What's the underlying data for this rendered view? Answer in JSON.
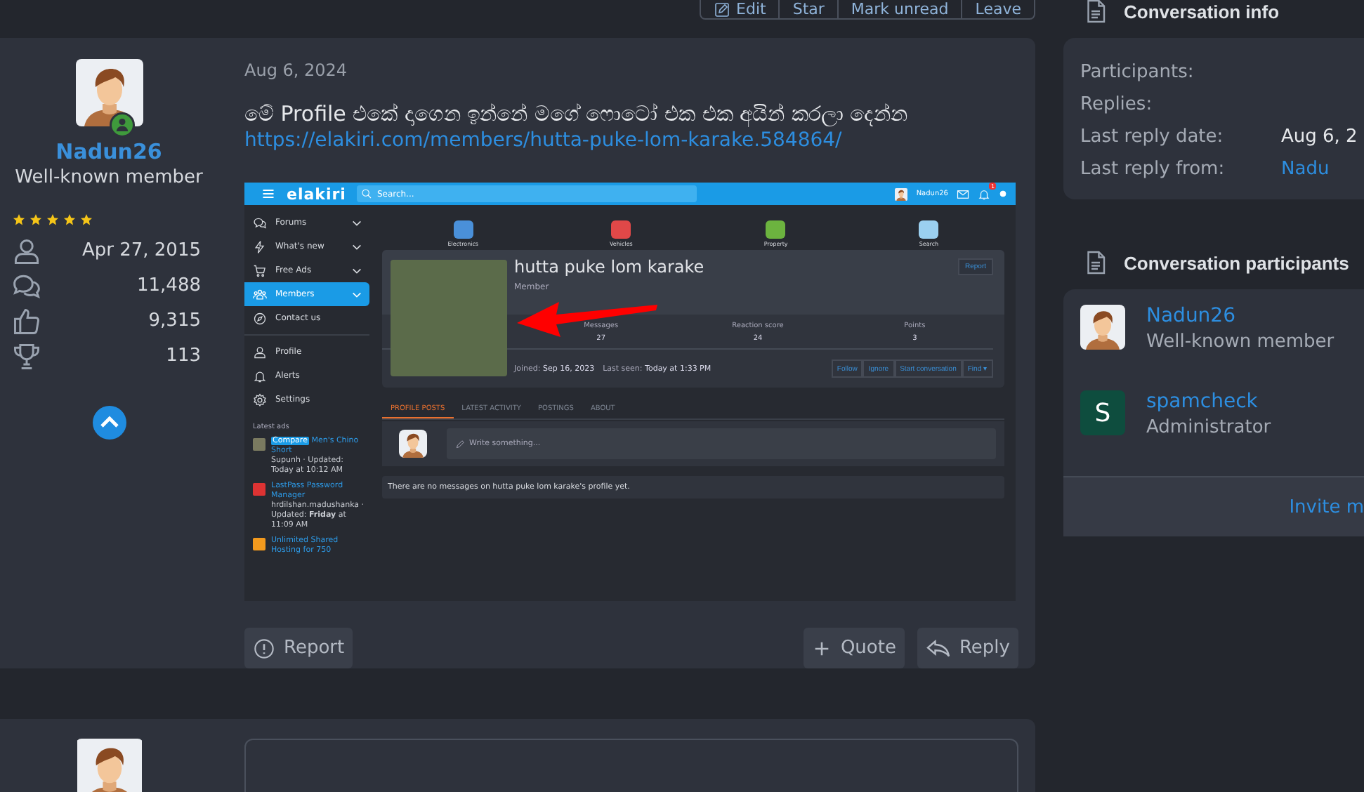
{
  "toolbar": {
    "buttons": [
      {
        "label": "Edit",
        "kind": "edit"
      },
      {
        "label": "Star",
        "kind": "plain"
      },
      {
        "label": "Mark unread",
        "kind": "plain"
      },
      {
        "label": "Leave",
        "kind": "plain"
      }
    ]
  },
  "post": {
    "author": {
      "name": "Nadun26",
      "title": "Well-known member",
      "online": true,
      "stars": 5,
      "stats": [
        {
          "kind": "joined",
          "value": "Apr 27, 2015"
        },
        {
          "kind": "messages",
          "value": "11,488"
        },
        {
          "kind": "reactions",
          "value": "9,315"
        },
        {
          "kind": "trophies",
          "value": "113"
        }
      ]
    },
    "date": "Aug 6, 2024",
    "message": "මේ Profile එකේ දාගෙන ඉන්නේ මගේ ෆොටෝ එක එක අයින් කරලා දෙන්න",
    "link": "https://elakiri.com/members/hutta-puke-lom-karake.584864/",
    "attachment": {
      "logo": "elakiri",
      "search_placeholder": "Search...",
      "user": "Nadun26",
      "alert_count": "1",
      "categories": [
        {
          "label": "Electronics",
          "kind": "electronics"
        },
        {
          "label": "Vehicles",
          "kind": "vehicles"
        },
        {
          "label": "Property",
          "kind": "property"
        },
        {
          "label": "Search",
          "kind": "search"
        }
      ],
      "nav": [
        {
          "label": "Forums",
          "kind": "forums",
          "selected": false,
          "dropdown": true
        },
        {
          "label": "What's new",
          "kind": "new",
          "selected": false,
          "dropdown": true
        },
        {
          "label": "Free Ads",
          "kind": "cart",
          "selected": false,
          "dropdown": true
        },
        {
          "label": "Members",
          "kind": "members",
          "selected": true,
          "dropdown": true
        },
        {
          "label": "Contact us",
          "kind": "contact",
          "selected": false,
          "dropdown": false
        }
      ],
      "account_nav": [
        {
          "label": "Profile",
          "kind": "profile"
        },
        {
          "label": "Alerts",
          "kind": "alerts"
        },
        {
          "label": "Settings",
          "kind": "settings"
        }
      ],
      "latest_ads_title": "Latest ads",
      "ads": [
        {
          "tag": "Compare",
          "title": "Men's Chino Short",
          "meta": "Supunh · Updated: Today at 10:12 AM",
          "kind": "clothes"
        },
        {
          "title": "LastPass Password Manager",
          "meta": "hrdilshan.madushanka · Updated: **Friday** at 11:09 AM",
          "kind": "software"
        },
        {
          "title": "Unlimited Shared Hosting for 750",
          "kind": "hosting"
        }
      ],
      "profile": {
        "name": "hutta puke lom karake",
        "role": "Member",
        "report": "Report",
        "stats": [
          {
            "label": "Messages",
            "value": "27"
          },
          {
            "label": "Reaction score",
            "value": "24"
          },
          {
            "label": "Points",
            "value": "3"
          }
        ],
        "joined": "Joined: **Sep 16, 2023**",
        "last_seen": "Last seen: **Today at 1:33 PM**",
        "buttons": [
          "Follow",
          "Ignore",
          "Start conversation",
          "Find ▾"
        ]
      },
      "tabs": [
        {
          "label": "PROFILE POSTS",
          "selected": true
        },
        {
          "label": "LATEST ACTIVITY",
          "selected": false
        },
        {
          "label": "POSTINGS",
          "selected": false
        },
        {
          "label": "ABOUT",
          "selected": false
        }
      ],
      "write_placeholder": "Write something...",
      "empty_message": "There are no messages on hutta puke lom karake's profile yet."
    },
    "actions": {
      "report": "Report",
      "quote": "Quote",
      "reply": "Reply"
    }
  },
  "sidebar": {
    "info": {
      "title": "Conversation info",
      "rows": [
        {
          "label": "Participants:"
        },
        {
          "label": "Replies:"
        },
        {
          "label": "Last reply date:",
          "value": "Aug 6, 2",
          "kind": "text"
        },
        {
          "label": "Last reply from:",
          "value": "Nadu",
          "kind": "link"
        }
      ]
    },
    "participants": {
      "title": "Conversation participants",
      "members": [
        {
          "name": "Nadun26",
          "title": "Well-known member"
        },
        {
          "name": "spamcheck",
          "title": "Administrator",
          "letter": "S",
          "color": "#0e4d3e"
        }
      ],
      "invite": "Invite m"
    }
  }
}
